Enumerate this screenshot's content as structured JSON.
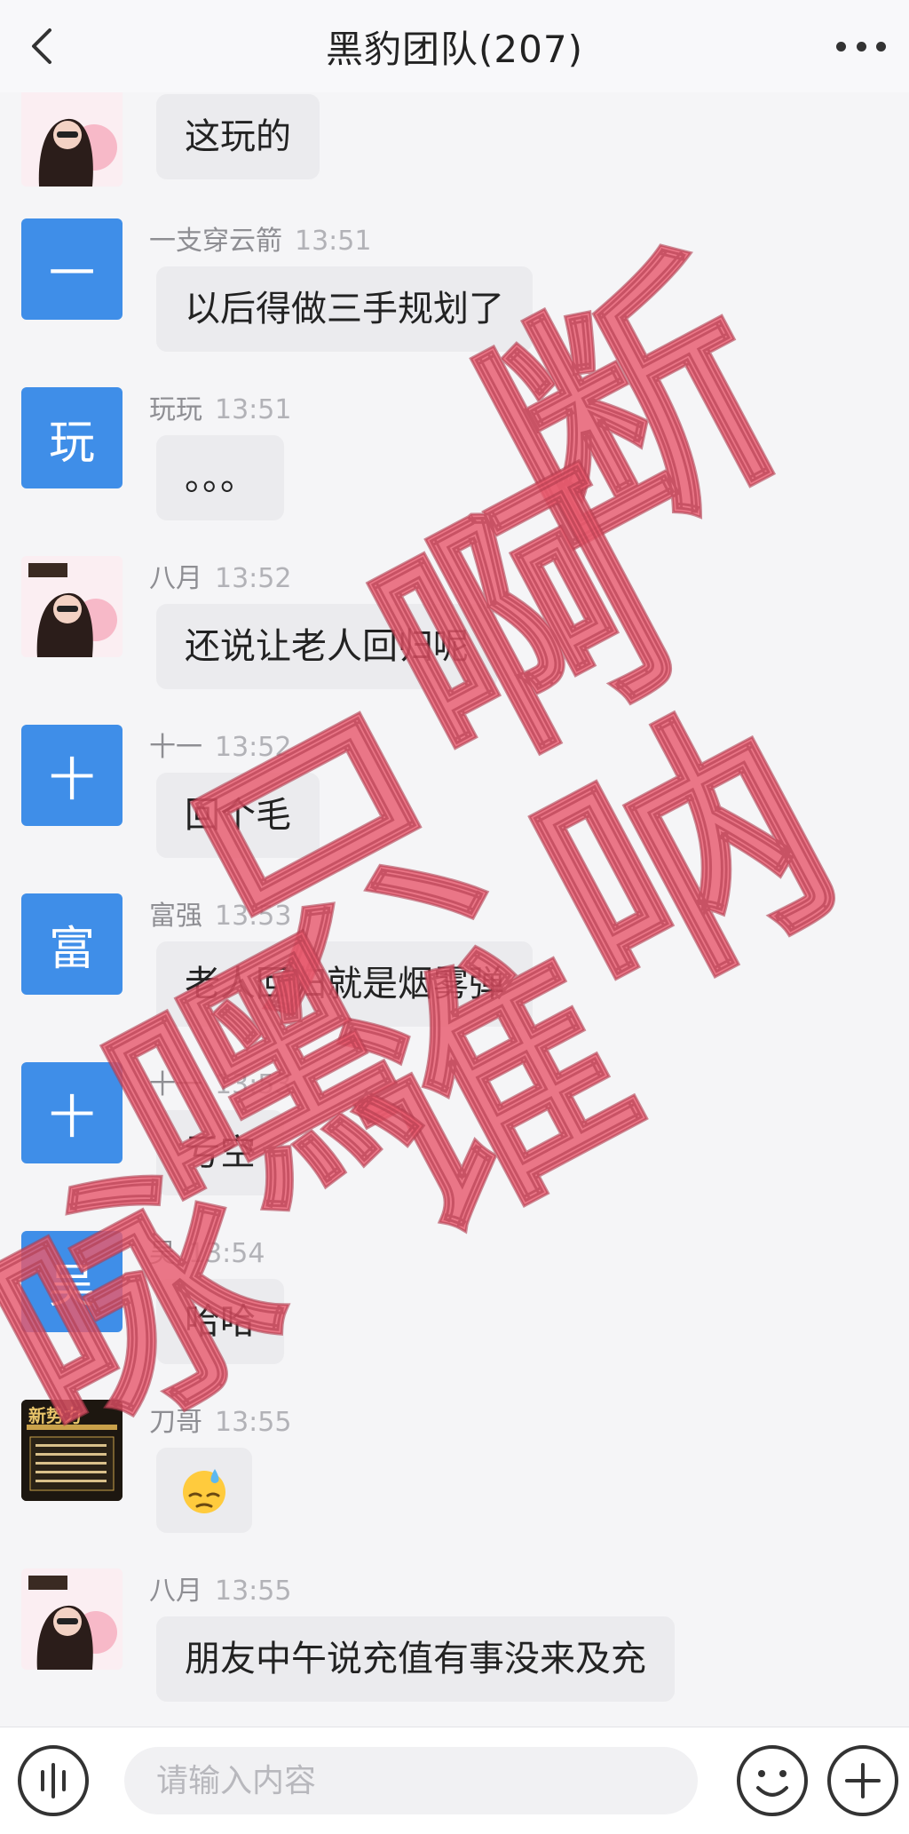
{
  "header": {
    "title": "黑豹团队(207)"
  },
  "messages": [
    {
      "sender": "",
      "time": "",
      "text": "这玩的",
      "avatar": {
        "type": "photo",
        "label": ""
      }
    },
    {
      "sender": "一支穿云箭",
      "time": "13:51",
      "text": "以后得做三手规划了",
      "avatar": {
        "type": "text",
        "label": "一"
      }
    },
    {
      "sender": "玩玩",
      "time": "13:51",
      "text": "。。。",
      "avatar": {
        "type": "text",
        "label": "玩"
      }
    },
    {
      "sender": "八月",
      "time": "13:52",
      "text": "还说让老人回归呢",
      "avatar": {
        "type": "photo",
        "label": ""
      }
    },
    {
      "sender": "十一",
      "time": "13:52",
      "text": "回个毛",
      "avatar": {
        "type": "text",
        "label": "十"
      }
    },
    {
      "sender": "富强",
      "time": "13:53",
      "text": "老人回归就是烟雾弹",
      "avatar": {
        "type": "text",
        "label": "富"
      }
    },
    {
      "sender": "十一",
      "time": "13:53",
      "text": "亏空",
      "avatar": {
        "type": "text",
        "label": "十"
      }
    },
    {
      "sender": "吴",
      "time": "13:54",
      "text": "哈哈",
      "avatar": {
        "type": "text",
        "label": "吴"
      }
    },
    {
      "sender": "刀哥",
      "time": "13:55",
      "text": "😓",
      "avatar": {
        "type": "poster",
        "label": "新势力"
      }
    },
    {
      "sender": "八月",
      "time": "13:55",
      "text": "朋友中午说充值有事没来及充",
      "avatar": {
        "type": "photo",
        "label": ""
      }
    }
  ],
  "watermark": {
    "lines": [
      "断",
      "啊",
      "呐",
      "只",
      "谁",
      "嘿",
      "咏"
    ],
    "color": "#e85a6e"
  },
  "input": {
    "placeholder": "请输入内容"
  },
  "icons": {
    "back": "chevron-left-icon",
    "more": "more-icon",
    "voice": "voice-icon",
    "emoji": "emoji-icon",
    "plus": "plus-icon"
  },
  "colors": {
    "avatar_blue": "#3f8ee8",
    "bubble": "#ebebee",
    "background": "#f5f5f7"
  }
}
